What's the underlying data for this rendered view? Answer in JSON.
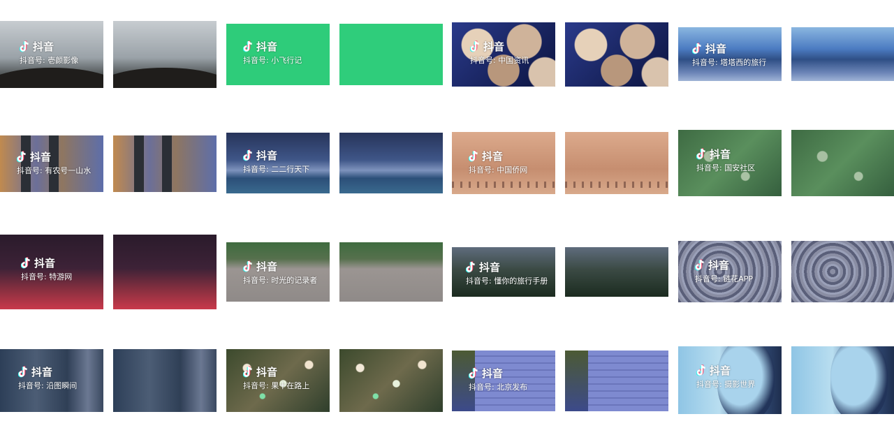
{
  "watermark": {
    "logo_text": "抖音",
    "account_prefix": "抖音号:"
  },
  "thumbnails": [
    {
      "row": 1,
      "col": 1,
      "scene": "bridge-stone-wall",
      "has_watermark": true,
      "account_name": "壱颜影像"
    },
    {
      "row": 1,
      "col": 2,
      "scene": "bridge-stone-wall",
      "has_watermark": false
    },
    {
      "row": 1,
      "col": 3,
      "scene": "green-screen",
      "has_watermark": true,
      "account_name": "小飞行记"
    },
    {
      "row": 1,
      "col": 4,
      "scene": "green-screen",
      "has_watermark": false
    },
    {
      "row": 1,
      "col": 5,
      "scene": "oysters",
      "has_watermark": true,
      "account_name": "中国资讯"
    },
    {
      "row": 1,
      "col": 6,
      "scene": "oysters",
      "has_watermark": false
    },
    {
      "row": 1,
      "col": 7,
      "scene": "blue-mountains",
      "has_watermark": true,
      "account_name": "塔塔西的旅行"
    },
    {
      "row": 1,
      "col": 8,
      "scene": "blue-mountains",
      "has_watermark": false
    },
    {
      "row": 2,
      "col": 1,
      "scene": "railing",
      "has_watermark": true,
      "account_name": "有农号一山水"
    },
    {
      "row": 2,
      "col": 2,
      "scene": "railing",
      "has_watermark": false
    },
    {
      "row": 2,
      "col": 3,
      "scene": "night-lake",
      "has_watermark": true,
      "account_name": "二二行天下"
    },
    {
      "row": 2,
      "col": 4,
      "scene": "night-lake",
      "has_watermark": false
    },
    {
      "row": 2,
      "col": 5,
      "scene": "peach-village",
      "has_watermark": true,
      "account_name": "中国侨网"
    },
    {
      "row": 2,
      "col": 6,
      "scene": "peach-village",
      "has_watermark": false
    },
    {
      "row": 2,
      "col": 7,
      "scene": "moss",
      "has_watermark": true,
      "account_name": "国安社区"
    },
    {
      "row": 2,
      "col": 8,
      "scene": "moss",
      "has_watermark": false
    },
    {
      "row": 3,
      "col": 1,
      "scene": "lava",
      "has_watermark": true,
      "account_name": "特游网"
    },
    {
      "row": 3,
      "col": 2,
      "scene": "lava",
      "has_watermark": false
    },
    {
      "row": 3,
      "col": 3,
      "scene": "courtyard",
      "has_watermark": true,
      "account_name": "时光的记录者"
    },
    {
      "row": 3,
      "col": 4,
      "scene": "courtyard",
      "has_watermark": false
    },
    {
      "row": 3,
      "col": 5,
      "scene": "trees",
      "has_watermark": true,
      "account_name": "懂你的旅行手册"
    },
    {
      "row": 3,
      "col": 6,
      "scene": "trees",
      "has_watermark": false
    },
    {
      "row": 3,
      "col": 7,
      "scene": "baroque-ceiling",
      "has_watermark": true,
      "account_name": "链花APP"
    },
    {
      "row": 3,
      "col": 8,
      "scene": "baroque-ceiling",
      "has_watermark": false
    },
    {
      "row": 4,
      "col": 1,
      "scene": "cliff",
      "has_watermark": true,
      "account_name": "沿图瞬间"
    },
    {
      "row": 4,
      "col": 2,
      "scene": "cliff",
      "has_watermark": false
    },
    {
      "row": 4,
      "col": 3,
      "scene": "sparkles",
      "has_watermark": true,
      "account_name": "果十在路上"
    },
    {
      "row": 4,
      "col": 4,
      "scene": "sparkles",
      "has_watermark": false
    },
    {
      "row": 4,
      "col": 5,
      "scene": "blue-wall",
      "has_watermark": true,
      "account_name": "北京发布"
    },
    {
      "row": 4,
      "col": 6,
      "scene": "blue-wall",
      "has_watermark": false
    },
    {
      "row": 4,
      "col": 7,
      "scene": "portrait",
      "has_watermark": true,
      "account_name": "摄影世界"
    },
    {
      "row": 4,
      "col": 8,
      "scene": "portrait",
      "has_watermark": false
    }
  ]
}
